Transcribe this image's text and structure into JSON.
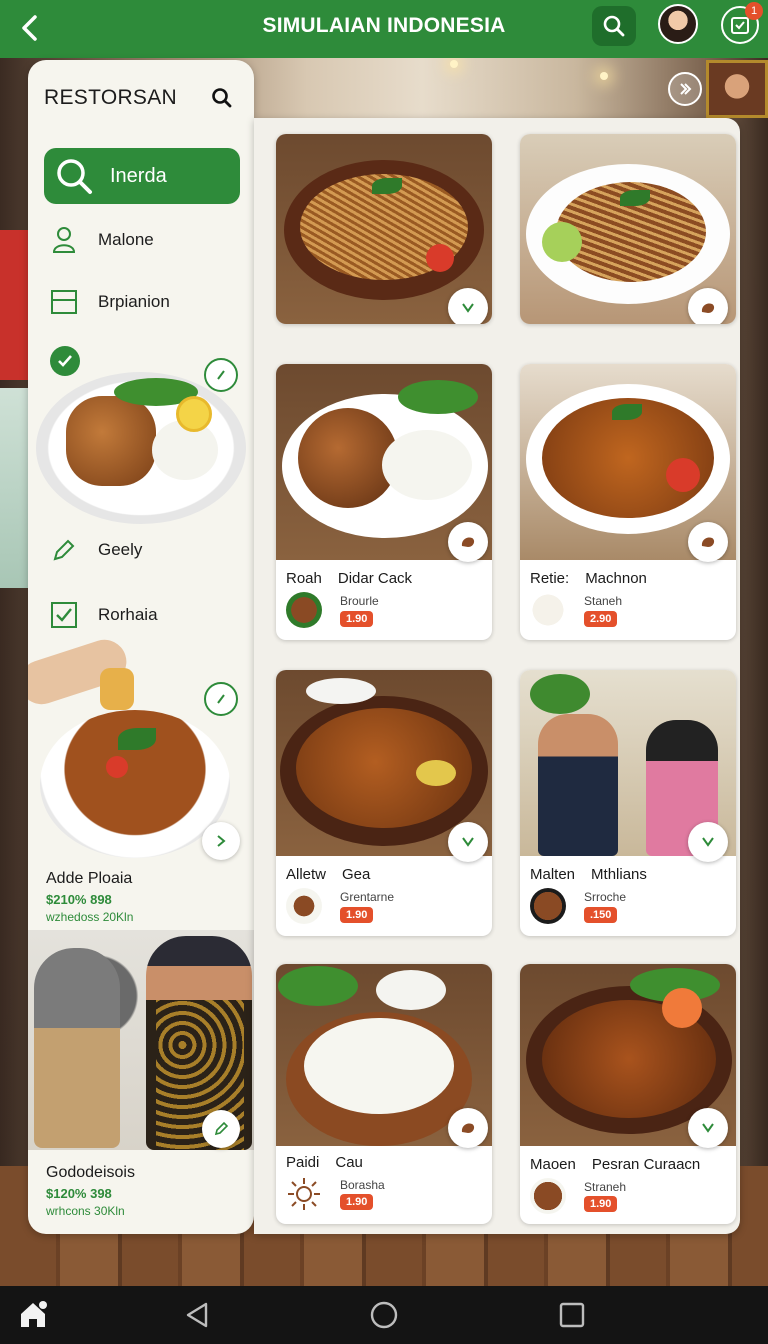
{
  "header": {
    "title": "SIMULAIAN INDONESIA",
    "notification_count": "1",
    "back_icon": "chevron-left-icon",
    "search_icon": "search-icon",
    "notif_icon": "calendar-check-icon"
  },
  "sidebar": {
    "title": "RESTORSAN",
    "active_item": {
      "label": "Inerda",
      "icon": "search-icon"
    },
    "items": [
      {
        "label": "Malone",
        "icon": "person-icon"
      },
      {
        "label": "Brpianion",
        "icon": "grid-icon"
      },
      {
        "label": "Geely",
        "icon": "pencil-icon"
      },
      {
        "label": "Rorhaia",
        "icon": "checkbox-icon"
      }
    ],
    "cards": [
      {
        "title": "Adde Ploaia",
        "price": "$210% 898",
        "sub": "wzhedoss 20Kln"
      },
      {
        "title": "Gododeisois",
        "price": "$120% 398",
        "sub": "wrhcons 30Kln"
      }
    ]
  },
  "grid": {
    "cards": [
      {
        "name_left": "",
        "name_right": "",
        "sub": "",
        "price": ""
      },
      {
        "name_left": "",
        "name_right": "",
        "sub": "",
        "price": ""
      },
      {
        "name_left": "Roah",
        "name_right": "Didar Cack",
        "sub": "Brourle",
        "price": "1.90"
      },
      {
        "name_left": "Retie:",
        "name_right": "Machnon",
        "sub": "Staneh",
        "price": "2.90"
      },
      {
        "name_left": "Alletw",
        "name_right": "Gea",
        "sub": "Grentarne",
        "price": "1.90"
      },
      {
        "name_left": "Malten",
        "name_right": "Mthlians",
        "sub": "Srroche",
        "price": ".150"
      },
      {
        "name_left": "Paidi",
        "name_right": "Cau",
        "sub": "Borasha",
        "price": "1.90"
      },
      {
        "name_left": "Maoen",
        "name_right": "Pesran Curaacn",
        "sub": "Straneh",
        "price": "1.90"
      }
    ]
  },
  "colors": {
    "brand_green": "#2e8b3a",
    "price_red": "#e4502b",
    "panel_bg": "#f2f0ea"
  },
  "system_nav": {
    "home_icon": "home-icon",
    "back_icon": "triangle-back-icon",
    "circle_icon": "circle-home-icon",
    "recents_icon": "square-recents-icon"
  }
}
